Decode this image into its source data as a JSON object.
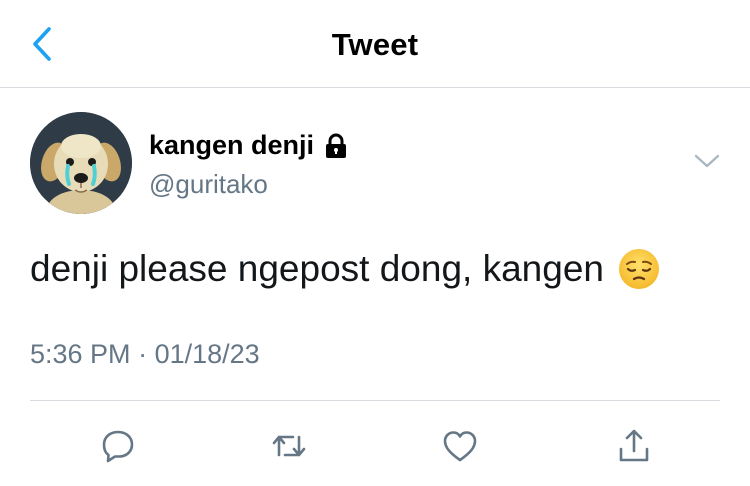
{
  "nav": {
    "back_icon": "chevron-left-icon",
    "title": "Tweet"
  },
  "tweet": {
    "display_name": "kangen denji",
    "protected_icon": "lock-icon",
    "handle": "@guritako",
    "text": "denji please ngepost dong, kangen",
    "emoji": "pensive-face",
    "time": "5:36 PM",
    "separator": "·",
    "date": "01/18/23"
  },
  "actions": {
    "reply_icon": "reply-icon",
    "retweet_icon": "retweet-icon",
    "like_icon": "heart-icon",
    "share_icon": "share-icon"
  },
  "colors": {
    "accent": "#1da1f2",
    "secondary_text": "#657786",
    "divider": "#d9dde1",
    "icon": "#657786"
  }
}
